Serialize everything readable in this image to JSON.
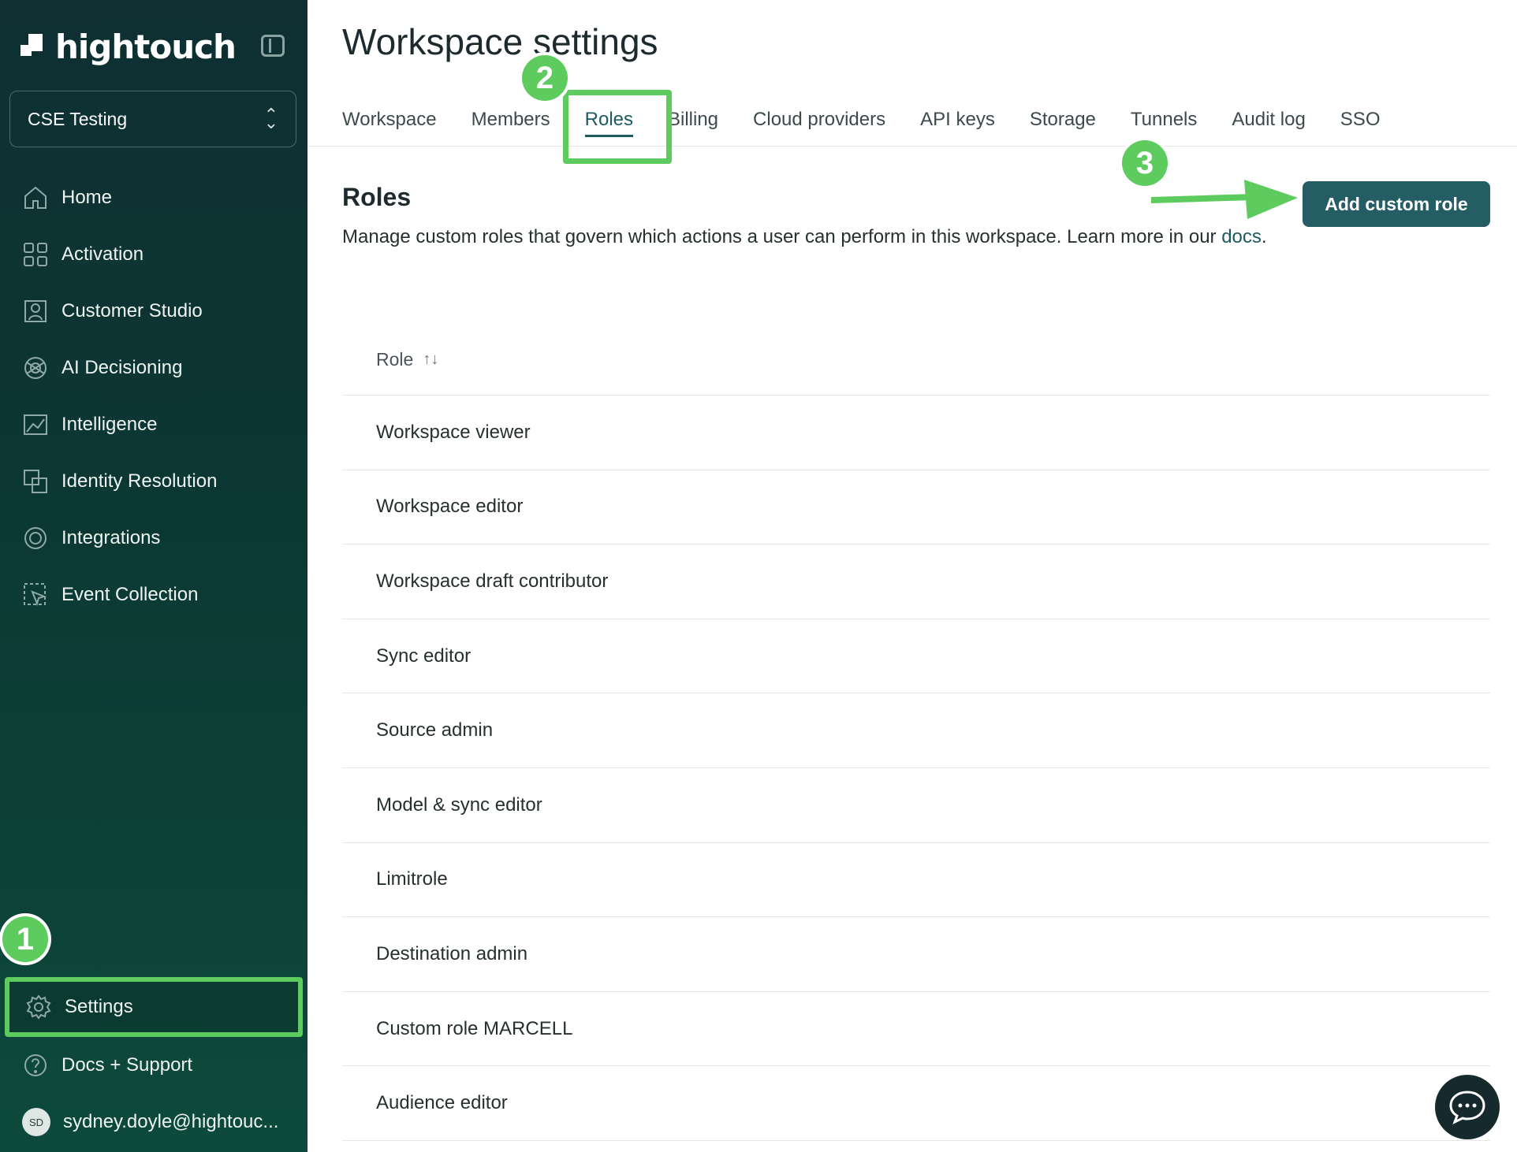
{
  "app": {
    "logo_text": "hightouch"
  },
  "workspace_selector": {
    "value": "CSE Testing"
  },
  "sidebar": {
    "items": [
      {
        "label": "Home",
        "icon": "home-icon"
      },
      {
        "label": "Activation",
        "icon": "grid-icon"
      },
      {
        "label": "Customer Studio",
        "icon": "user-frame-icon"
      },
      {
        "label": "AI Decisioning",
        "icon": "ai-icon"
      },
      {
        "label": "Intelligence",
        "icon": "chart-icon"
      },
      {
        "label": "Identity Resolution",
        "icon": "identity-icon"
      },
      {
        "label": "Integrations",
        "icon": "integrations-icon"
      },
      {
        "label": "Event Collection",
        "icon": "cursor-icon"
      }
    ],
    "bottom": {
      "settings": "Settings",
      "docs": "Docs + Support",
      "user_initials": "SD",
      "user_email": "sydney.doyle@hightouc..."
    }
  },
  "header": {
    "title": "Workspace settings",
    "tabs": [
      "Workspace",
      "Members",
      "Roles",
      "Billing",
      "Cloud providers",
      "API keys",
      "Storage",
      "Tunnels",
      "Audit log",
      "SSO"
    ],
    "active_tab": "Roles"
  },
  "roles_section": {
    "title": "Roles",
    "description": "Manage custom roles that govern which actions a user can perform in this workspace. Learn more in our ",
    "docs_link": "docs",
    "description_end": ".",
    "add_button": "Add custom role"
  },
  "table": {
    "header": "Role",
    "sort_icon": "sort-icon",
    "rows": [
      "Workspace viewer",
      "Workspace editor",
      "Workspace draft contributor",
      "Sync editor",
      "Source admin",
      "Model & sync editor",
      "Limitrole",
      "Destination admin",
      "Custom role MARCELL",
      "Audience editor"
    ]
  },
  "annotations": {
    "step1": "1",
    "step2": "2",
    "step3": "3"
  },
  "colors": {
    "accent": "#245d63",
    "highlight": "#5ecb5e",
    "sidebar_bg": "#0f3a36"
  }
}
